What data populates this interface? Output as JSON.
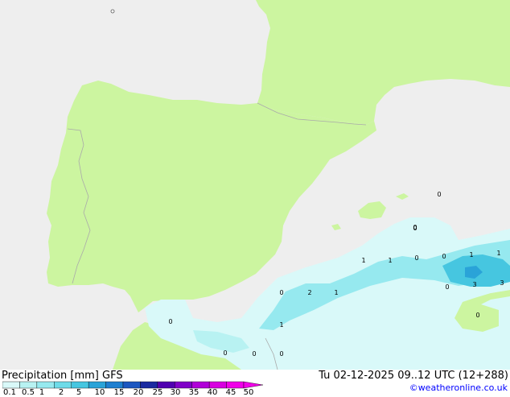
{
  "map": {
    "sea_color": "#eeeeee",
    "land_color": "#ccf5a0",
    "border_color": "#aaaaaa",
    "rain_values": [
      "0",
      "0",
      "1",
      "2",
      "1",
      "1",
      "1",
      "0",
      "0",
      "1",
      "1",
      "3",
      "3",
      "0",
      "0",
      "0",
      "0",
      "0",
      "0",
      "0",
      "0"
    ]
  },
  "footer": {
    "title": "Precipitation [mm] GFS",
    "run": "Tu 02-12-2025 09..12 UTC (12+288)",
    "credit": "©weatheronline.co.uk",
    "scale_labels": [
      "0.1",
      "0.5",
      "1",
      "2",
      "5",
      "10",
      "15",
      "20",
      "25",
      "30",
      "35",
      "40",
      "45",
      "50"
    ],
    "scale_colors": [
      "#d9f9f9",
      "#b8f2f2",
      "#96e9ef",
      "#6edbe8",
      "#46c6e0",
      "#2aa3d8",
      "#1e7fd0",
      "#1c57c0",
      "#1a2aa0",
      "#5000b0",
      "#8000c8",
      "#b000d8",
      "#d800e0",
      "#f000e8"
    ]
  }
}
